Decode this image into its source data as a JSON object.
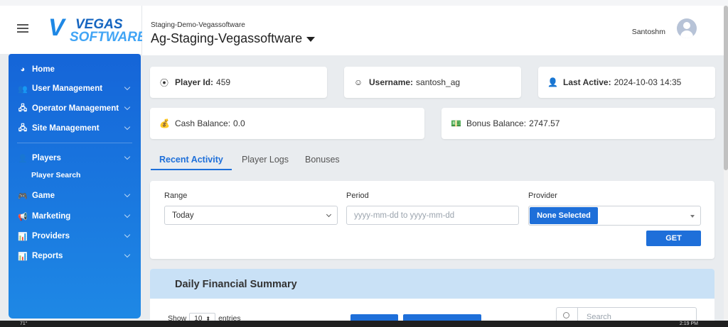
{
  "sidebar": {
    "items": [
      {
        "label": "Home",
        "icon": "pie-chart-icon",
        "glyph": "◕",
        "has_chevron": false
      },
      {
        "label": "User Management",
        "icon": "users-icon",
        "glyph": "👥",
        "has_chevron": true
      },
      {
        "label": "Operator Management",
        "icon": "sitemap-icon",
        "glyph": "🖧",
        "has_chevron": true
      },
      {
        "label": "Site Management",
        "icon": "sitemap-icon",
        "glyph": "🖧",
        "has_chevron": true
      },
      {
        "label": "Players",
        "icon": "user-icon",
        "glyph": "👤",
        "has_chevron": true
      },
      {
        "label": "Game",
        "icon": "gamepad-icon",
        "glyph": "🎮",
        "has_chevron": true
      },
      {
        "label": "Marketing",
        "icon": "megaphone-icon",
        "glyph": "📢",
        "has_chevron": true
      },
      {
        "label": "Providers",
        "icon": "bar-chart-icon",
        "glyph": "📊",
        "has_chevron": true
      },
      {
        "label": "Reports",
        "icon": "bar-chart-icon",
        "glyph": "📊",
        "has_chevron": true
      }
    ],
    "sub_item": "Player Search"
  },
  "logo": {
    "mark": "V",
    "line1": "VEGAS",
    "line2": "SOFTWARE"
  },
  "header": {
    "subtitle": "Staging-Demo-Vegassoftware",
    "title": "Ag-Staging-Vegassoftware",
    "user": "Santoshm"
  },
  "cards": {
    "player_id": {
      "label": "Player Id:",
      "value": "459"
    },
    "username": {
      "label": "Username:",
      "value": "santosh_ag"
    },
    "last_active": {
      "label": "Last Active:",
      "value": "2024-10-03 14:35"
    },
    "cash_balance": {
      "label": "Cash Balance:",
      "value": "0.0"
    },
    "bonus_balance": {
      "label": "Bonus Balance:",
      "value": "2747.57"
    }
  },
  "tabs": [
    "Recent Activity",
    "Player Logs",
    "Bonuses"
  ],
  "filters": {
    "range_label": "Range",
    "range_value": "Today",
    "period_label": "Period",
    "period_placeholder": "yyyy-mm-dd to yyyy-mm-dd",
    "provider_label": "Provider",
    "provider_value": "None Selected",
    "get_label": "GET"
  },
  "summary": {
    "title": "Daily Financial Summary",
    "show_prefix": "Show",
    "show_value": "10",
    "show_suffix": "entries",
    "search_placeholder": "Search"
  },
  "taskbar": {
    "left": "71°",
    "time": "2:19 PM"
  },
  "colors": {
    "primary": "#1e6fd9",
    "sidebar_top": "#1565d8",
    "summary_header": "#c9e1f6"
  }
}
